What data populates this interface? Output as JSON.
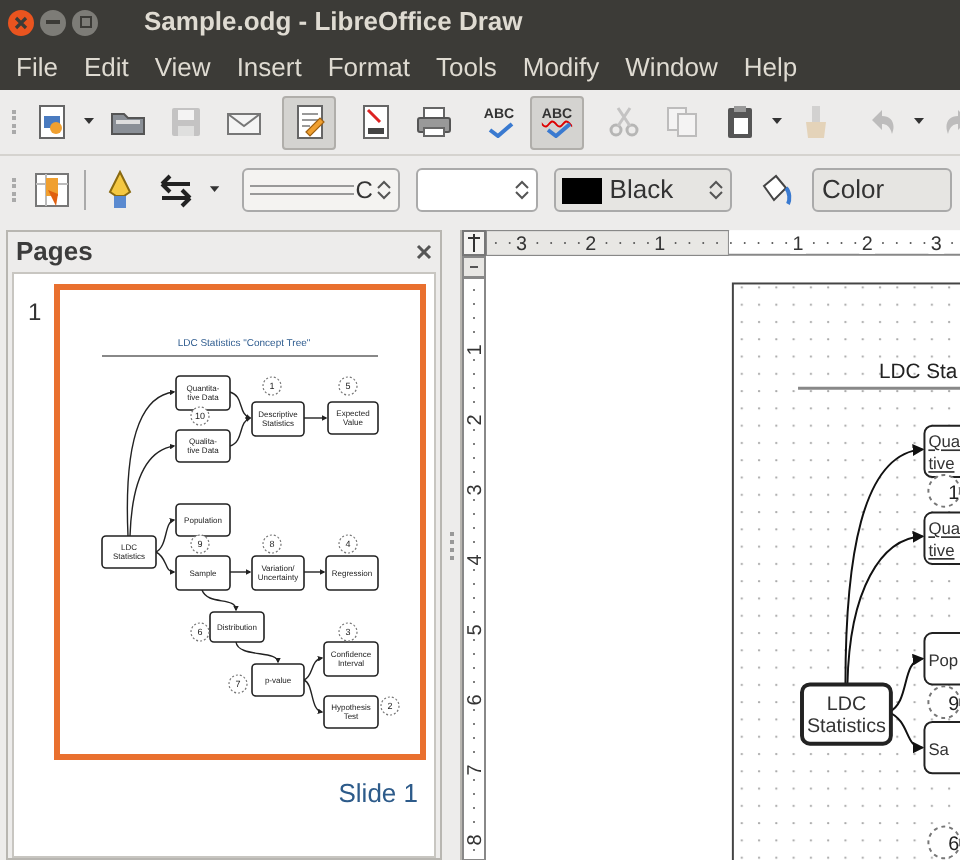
{
  "window": {
    "title": "Sample.odg - LibreOffice Draw"
  },
  "menu": [
    "File",
    "Edit",
    "View",
    "Insert",
    "Format",
    "Tools",
    "Modify",
    "Window",
    "Help"
  ],
  "standard_toolbar": [
    {
      "kind": "new",
      "dropdown": true,
      "disabled": false,
      "pressed": false
    },
    {
      "kind": "open",
      "dropdown": false,
      "disabled": false,
      "pressed": false
    },
    {
      "kind": "save",
      "dropdown": false,
      "disabled": true,
      "pressed": false
    },
    {
      "kind": "mail",
      "dropdown": false,
      "disabled": false,
      "pressed": false
    },
    {
      "kind": "sep"
    },
    {
      "kind": "edit",
      "dropdown": false,
      "disabled": false,
      "pressed": true
    },
    {
      "kind": "sep"
    },
    {
      "kind": "pdf",
      "dropdown": false,
      "disabled": false,
      "pressed": false
    },
    {
      "kind": "print",
      "dropdown": false,
      "disabled": false,
      "pressed": false
    },
    {
      "kind": "sep"
    },
    {
      "kind": "spell",
      "text": "ABC",
      "dropdown": false,
      "disabled": false,
      "pressed": false
    },
    {
      "kind": "autospell",
      "text": "ABC",
      "dropdown": false,
      "disabled": false,
      "pressed": true
    },
    {
      "kind": "sep"
    },
    {
      "kind": "cut",
      "dropdown": false,
      "disabled": true,
      "pressed": false
    },
    {
      "kind": "copy",
      "dropdown": false,
      "disabled": true,
      "pressed": false
    },
    {
      "kind": "paste",
      "dropdown": true,
      "disabled": false,
      "pressed": false
    },
    {
      "kind": "clone",
      "dropdown": false,
      "disabled": true,
      "pressed": false
    },
    {
      "kind": "sep"
    },
    {
      "kind": "undo",
      "dropdown": true,
      "disabled": true,
      "pressed": false
    },
    {
      "kind": "redo",
      "dropdown": false,
      "disabled": true,
      "pressed": false
    }
  ],
  "line_toolbar": {
    "line_style": {
      "value": "C"
    },
    "line_color": {
      "value": "Black",
      "color": "#000000"
    },
    "area_style": {
      "value": "Color"
    }
  },
  "pages_panel": {
    "title": "Pages",
    "pages": [
      {
        "number": "1",
        "label": "Slide 1",
        "selected": true,
        "thumbnail": {
          "title": "LDC Statistics \"Concept Tree\"",
          "nodes": [
            {
              "lines": [
                "Quantita-",
                "tive Data"
              ]
            },
            {
              "lines": [
                "Qualita-",
                "tive Data"
              ]
            },
            {
              "lines": [
                "Descriptive",
                "Statistics"
              ]
            },
            {
              "lines": [
                "Expected",
                "Value"
              ]
            },
            {
              "lines": [
                "Population"
              ]
            },
            {
              "lines": [
                "LDC",
                "Statistics"
              ]
            },
            {
              "lines": [
                "Sample"
              ]
            },
            {
              "lines": [
                "Variation/",
                "Uncertainty"
              ]
            },
            {
              "lines": [
                "Regression"
              ]
            },
            {
              "lines": [
                "Distribution"
              ]
            },
            {
              "lines": [
                "Confidence",
                "Interval"
              ]
            },
            {
              "lines": [
                "p-value"
              ]
            },
            {
              "lines": [
                "Hypothesis",
                "Test"
              ]
            }
          ],
          "badges": [
            "1",
            "5",
            "10",
            "9",
            "8",
            "4",
            "6",
            "3",
            "7",
            "2"
          ]
        }
      }
    ]
  },
  "rulers": {
    "horizontal": [
      "3",
      "2",
      "1",
      "1",
      "2",
      "3"
    ],
    "vertical": [
      "1",
      "2",
      "3",
      "4",
      "5",
      "6",
      "7",
      "8"
    ]
  },
  "canvas": {
    "title": "LDC Sta",
    "nodes": [
      {
        "lines": [
          "Qua",
          "tive"
        ],
        "misspelled": true
      },
      {
        "lines": [
          "Qua",
          "tive"
        ],
        "misspelled": true
      },
      {
        "lines": [
          "Pop"
        ],
        "misspelled": false
      },
      {
        "lines": [
          "LDC",
          "Statistics"
        ],
        "misspelled": false
      },
      {
        "lines": [
          "Sa"
        ],
        "misspelled": false
      }
    ],
    "badges": [
      "1",
      "9",
      "6"
    ]
  }
}
